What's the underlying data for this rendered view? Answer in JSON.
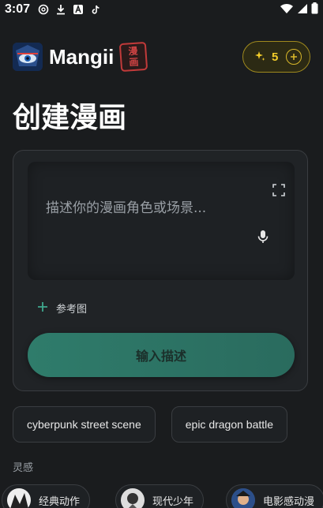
{
  "status_bar": {
    "time": "3:07",
    "left_icons": [
      "at-sign-icon",
      "download-icon",
      "app-a-icon",
      "tiktok-icon"
    ],
    "right_icons": [
      "wifi-icon",
      "signal-icon",
      "battery-icon"
    ]
  },
  "header": {
    "app_name": "Mangii",
    "stamp_text": [
      "漫",
      "画"
    ],
    "credits": "5"
  },
  "page_title": "创建漫画",
  "prompt": {
    "placeholder": "描述你的漫画角色或场景...",
    "value": ""
  },
  "reference_image_label": "参考图",
  "generate_button_label": "输入描述",
  "suggestions": [
    "cyberpunk street scene",
    "epic dragon battle"
  ],
  "inspiration_label": "灵感",
  "styles": [
    "经典动作",
    "现代少年",
    "电影感动漫"
  ],
  "colors": {
    "background": "#1a1c1e",
    "accent": "#2f7c6b",
    "gold": "#f2cc2a",
    "stamp_red": "#c23a3a"
  }
}
